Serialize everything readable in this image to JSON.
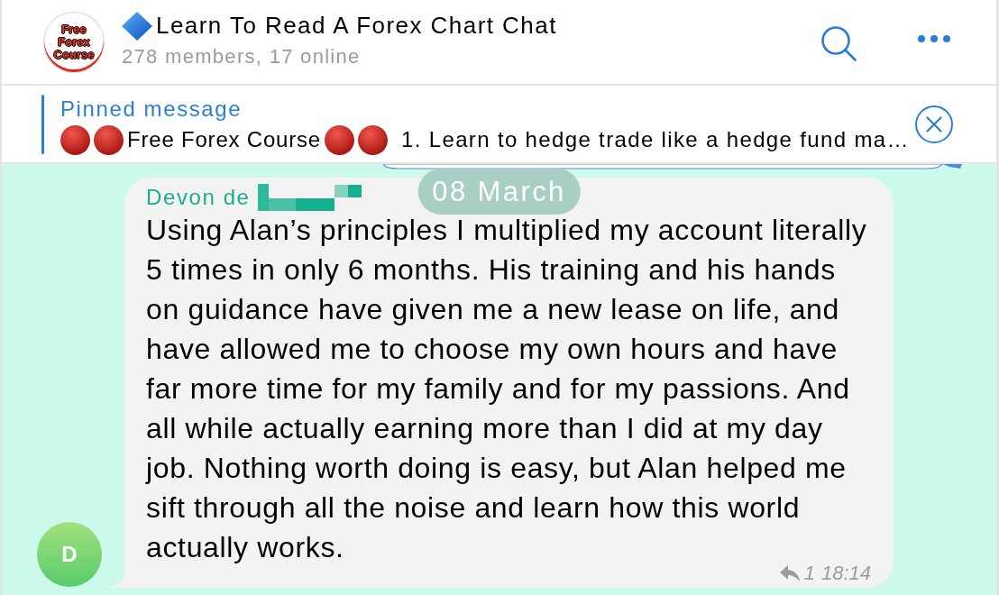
{
  "header": {
    "logo_text": "Free Forex Course",
    "title": "Learn To Read A Forex Chart Chat",
    "subtitle": "278 members, 17 online"
  },
  "pinned": {
    "label": "Pinned message",
    "course_name": "Free Forex Course",
    "preview": "1. Learn to hedge trade like a hedge fund ma…"
  },
  "date_badge": "08 March",
  "message": {
    "sender": "Devon de",
    "avatar_letter": "D",
    "text": "Using Alan’s principles I multiplied my account literally 5 times in only 6 months. His training and his hands on guidance have given me a new lease on life, and have allowed me to choose my own hours and have far more time for my family and for my passions. And all while actually earning more than I did at my day job. Nothing worth doing is easy, but Alan helped me sift through all the noise and learn how this world actually works.",
    "reply_count": "1",
    "time": "18:14"
  }
}
